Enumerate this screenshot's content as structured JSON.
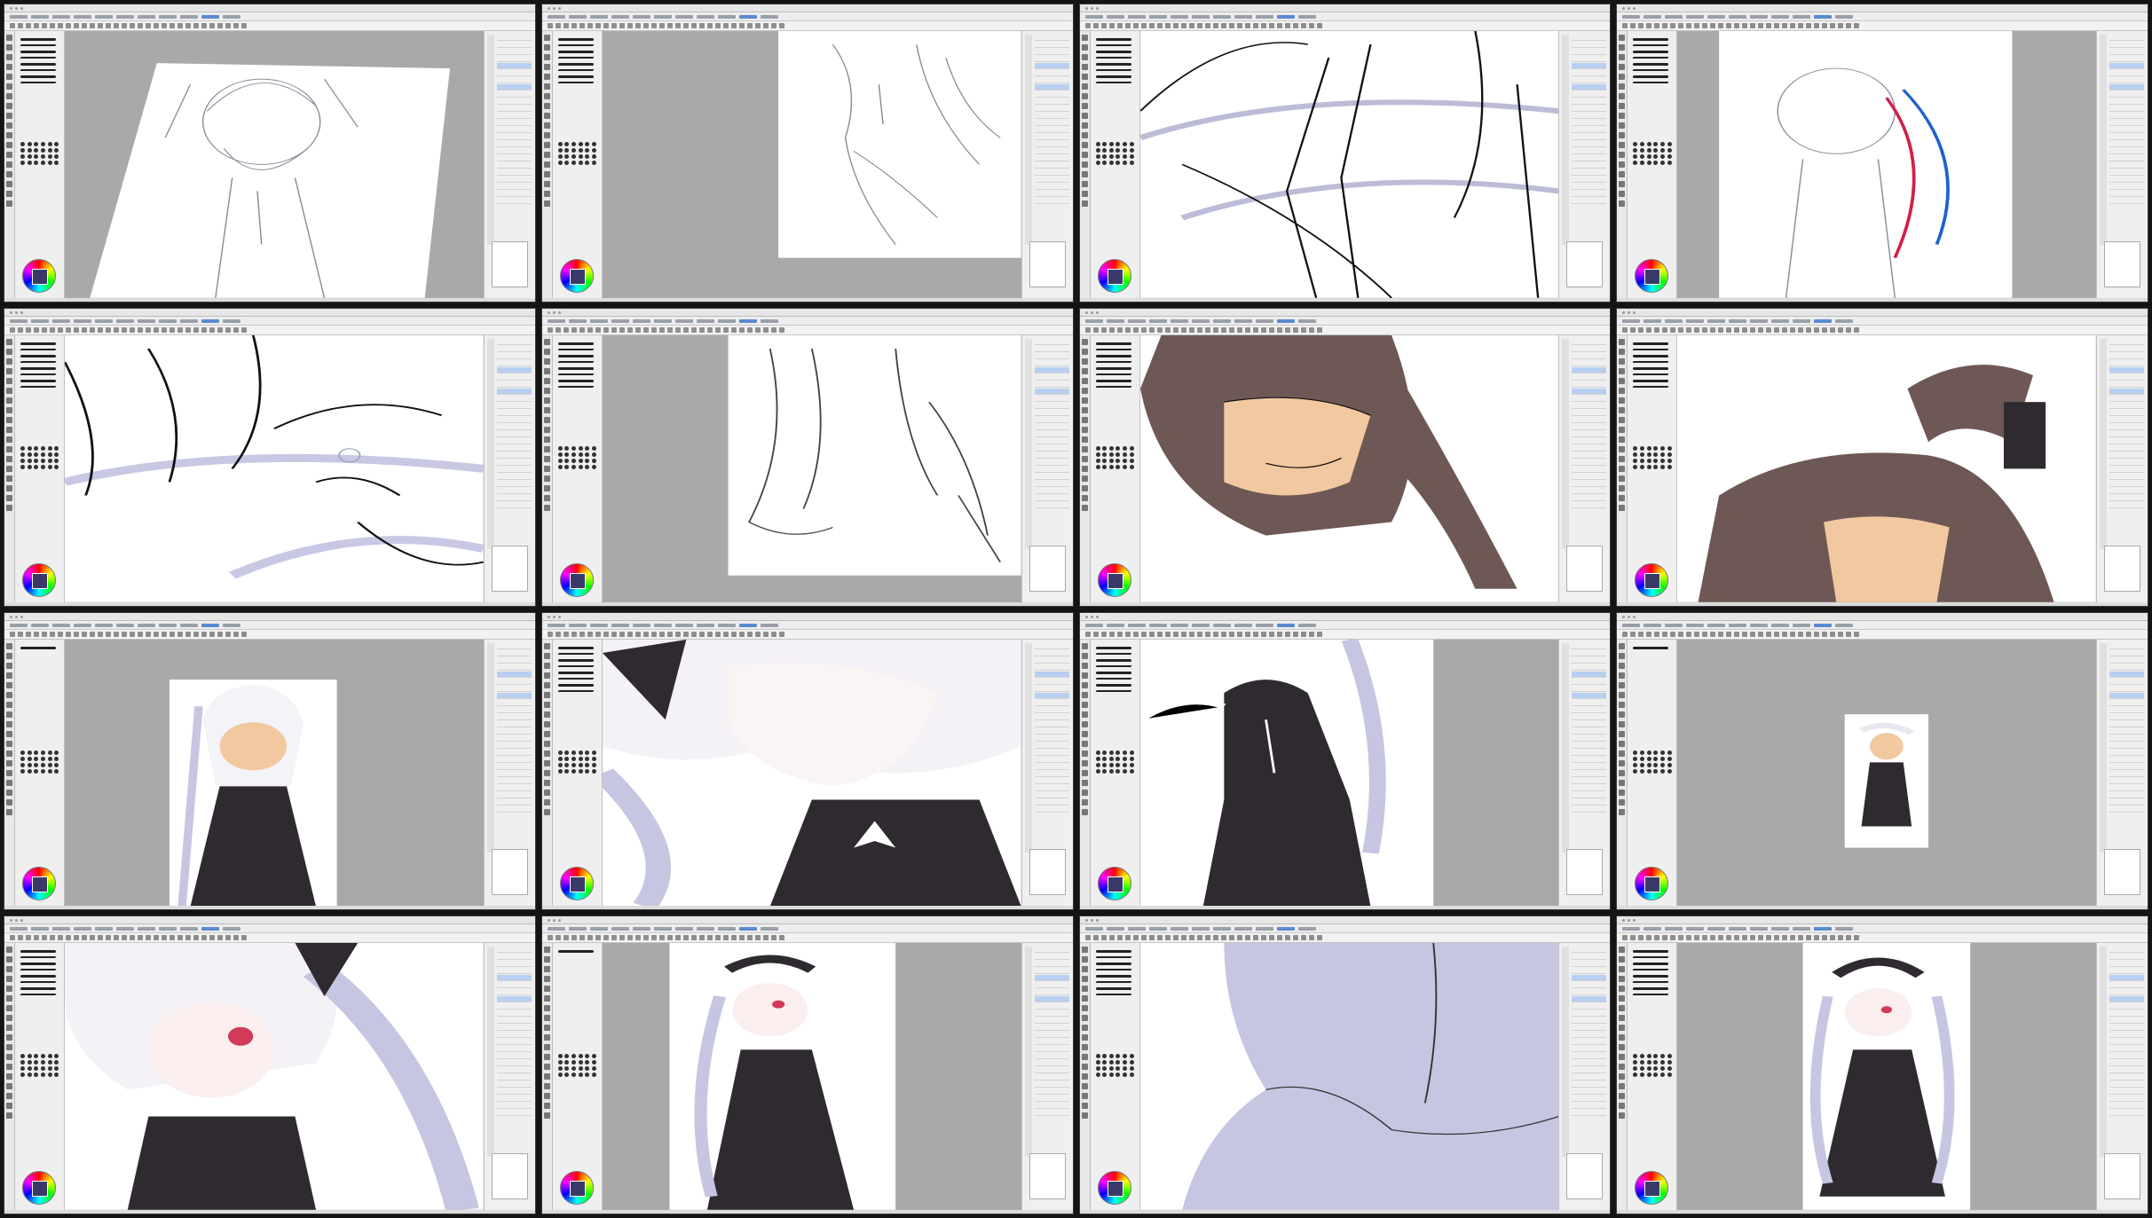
{
  "app": {
    "title": "",
    "frame_count": 16
  },
  "colors": {
    "bg_gray": "#a9a9a9",
    "panel": "#efefef",
    "hair_brown": "#6e5856",
    "skin": "#f2c8a0",
    "dress_black": "#2e2a30",
    "lavender": "#c6c6e2",
    "selected_layer": "#b7cff0",
    "eye_red": "#d23a5a"
  },
  "icons": [
    "gear-icon",
    "brush-icon",
    "eraser-icon",
    "color-wheel-icon",
    "layer-icon",
    "navigator-icon"
  ],
  "frames": [
    {
      "scene": "sketch-rotated"
    },
    {
      "scene": "sketch-partial"
    },
    {
      "scene": "lineart-closeup"
    },
    {
      "scene": "sketch-colored-lines"
    },
    {
      "scene": "lineart-face"
    },
    {
      "scene": "lineart-hair"
    },
    {
      "scene": "flat-brown-face"
    },
    {
      "scene": "flat-brown-top"
    },
    {
      "scene": "color-full"
    },
    {
      "scene": "color-face-closeup"
    },
    {
      "scene": "color-dress"
    },
    {
      "scene": "color-small"
    },
    {
      "scene": "render-face"
    },
    {
      "scene": "render-full"
    },
    {
      "scene": "lavender-closeup"
    },
    {
      "scene": "final"
    }
  ]
}
